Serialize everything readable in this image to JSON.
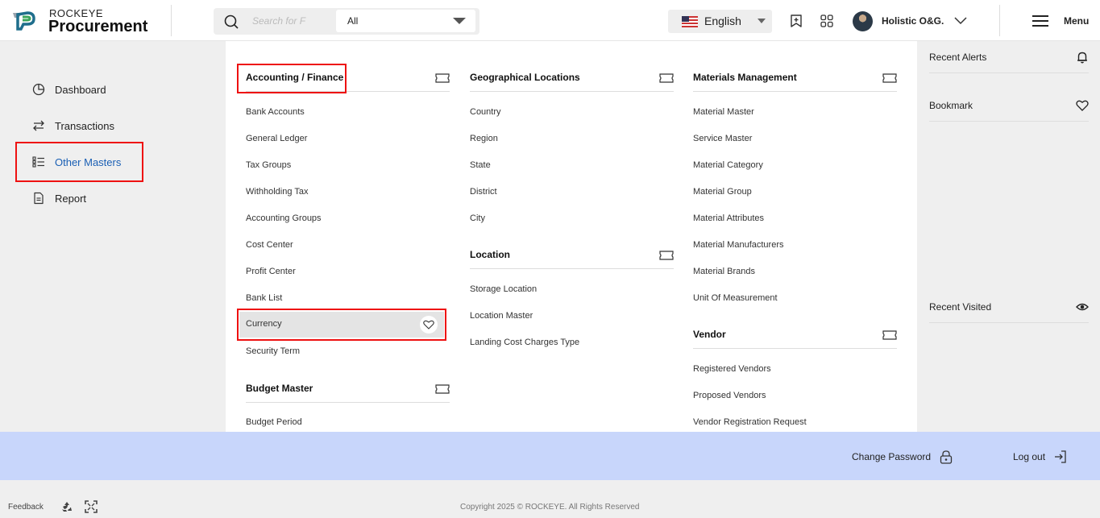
{
  "header": {
    "brand_top": "ROCKEYE",
    "brand_main": "Procurement",
    "search_placeholder": "Search for F",
    "search_scope": "All",
    "language": "English",
    "user_name": "Holistic O&G.",
    "menu_label": "Menu"
  },
  "sidebar": {
    "items": [
      {
        "label": "Dashboard",
        "icon": "pie-chart-icon"
      },
      {
        "label": "Transactions",
        "icon": "swap-arrows-icon"
      },
      {
        "label": "Other Masters",
        "icon": "list-icon",
        "active": true
      },
      {
        "label": "Report",
        "icon": "document-icon"
      }
    ]
  },
  "mega_menu": {
    "columns": [
      {
        "sections": [
          {
            "title": "Accounting / Finance",
            "items": [
              "Bank Accounts",
              "General Ledger",
              "Tax Groups",
              "Withholding Tax",
              "Accounting Groups",
              "Cost Center",
              "Profit Center",
              "Bank List",
              "Currency",
              "Security Term"
            ]
          },
          {
            "title": "Budget Master",
            "items": [
              "Budget Period"
            ]
          }
        ]
      },
      {
        "sections": [
          {
            "title": "Geographical Locations",
            "items": [
              "Country",
              "Region",
              "State",
              "District",
              "City"
            ]
          },
          {
            "title": "Location",
            "items": [
              "Storage Location",
              "Location Master",
              "Landing Cost Charges Type"
            ]
          }
        ]
      },
      {
        "sections": [
          {
            "title": "Materials Management",
            "items": [
              "Material Master",
              "Service Master",
              "Material Category",
              "Material Group",
              "Material Attributes",
              "Material Manufacturers",
              "Material Brands",
              "Unit Of Measurement"
            ]
          },
          {
            "title": "Vendor",
            "items": [
              "Registered Vendors",
              "Proposed Vendors",
              "Vendor Registration Request"
            ]
          }
        ]
      }
    ]
  },
  "right_panel": {
    "recent_alerts": "Recent Alerts",
    "bookmark": "Bookmark",
    "recent_visited": "Recent Visited"
  },
  "bottom_bar": {
    "change_password": "Change Password",
    "log_out": "Log out"
  },
  "footer": {
    "feedback": "Feedback",
    "copyright": "Copyright 2025 © ROCKEYE. All Rights Reserved"
  },
  "colors": {
    "accent": "#1a5fb4",
    "highlight": "#ee1111",
    "bottom_bar": "#c8d6fb"
  }
}
